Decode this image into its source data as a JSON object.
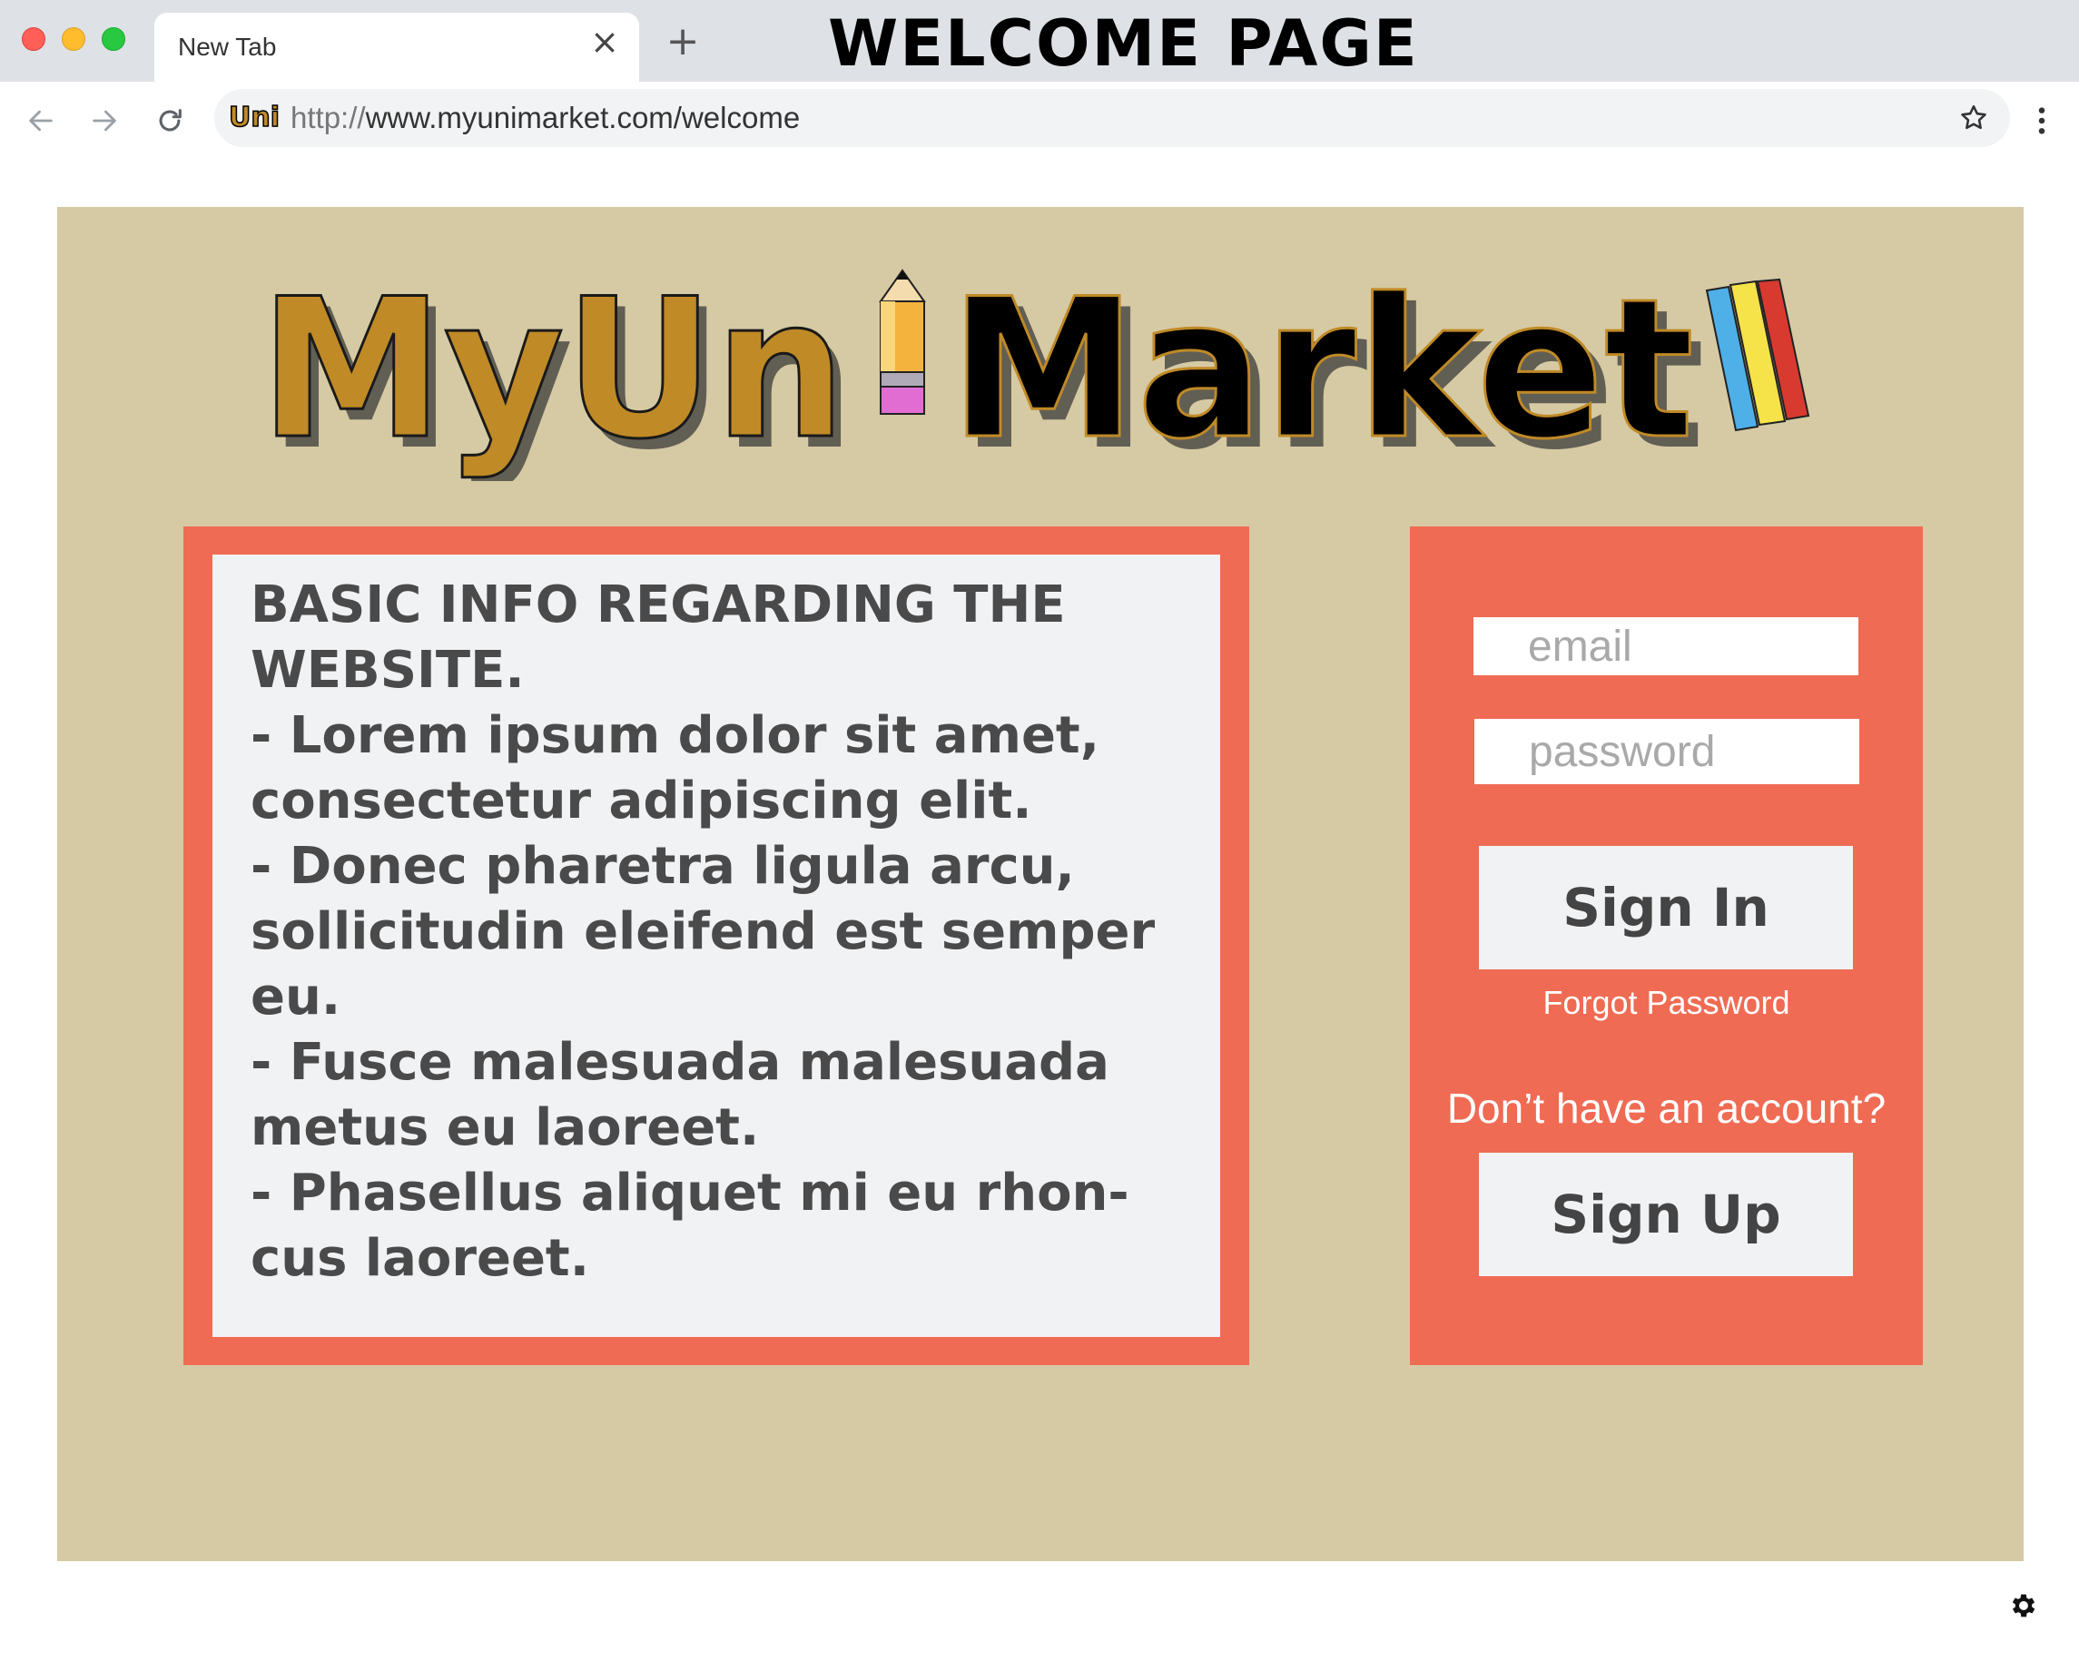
{
  "browser": {
    "tab_title": "New Tab",
    "tab_close_glyph": "×",
    "new_tab_glyph": "+",
    "url_scheme": "http://",
    "url_rest": "www.myunimarket.com/welcome",
    "favicon_text": "Uni",
    "icons": [
      "back-arrow-icon",
      "forward-arrow-icon",
      "reload-icon",
      "star-icon",
      "more-menu-icon",
      "settings-gear-icon"
    ]
  },
  "page_heading": "WELCOME PAGE",
  "logo": {
    "part1": "MyUn",
    "part2": "Market",
    "colors": {
      "gold": "#c08a26",
      "black": "#000000"
    }
  },
  "info": {
    "text": "BASIC INFO REGARDING THE WEBSITE.\n- Lorem ipsum dolor sit amet, consectetur adipiscing elit.\n- Donec pharetra ligula arcu, sollicitudin eleifend est semper eu.\n- Fusce malesuada malesuada metus eu laoreet.\n- Phasellus aliquet mi eu rhon-cus laoreet."
  },
  "login": {
    "email_placeholder": "email",
    "password_placeholder": "password",
    "sign_in_label": "Sign In",
    "forgot_label": "Forgot Password",
    "no_account_text": "Don’t have an account?",
    "sign_up_label": "Sign Up"
  },
  "colors": {
    "page_bg": "#d6caa4",
    "panel": "#ef6b53",
    "card": "#f1f2f4",
    "text_dark": "#4a4a4a"
  }
}
